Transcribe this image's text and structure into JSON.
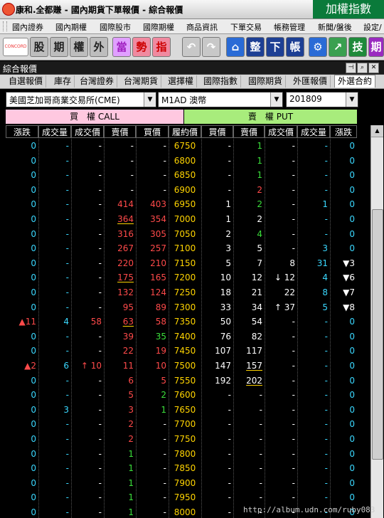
{
  "window": {
    "title": "康和.全都賺 - 國內期貨下單報價 - 綜合報價",
    "index_button": "加權指數"
  },
  "menu": [
    "國內證券",
    "國內期權",
    "國際股市",
    "國際期權",
    "商品資訊",
    "下單交易",
    "帳務管理",
    "新聞/盤後",
    "設定/"
  ],
  "toolbar": {
    "logo_text": "CONCORD",
    "buttons": [
      "股",
      "期",
      "權",
      "外",
      "當",
      "勢",
      "指",
      "整",
      "下",
      "帳",
      "技",
      "期"
    ]
  },
  "panel": {
    "title": "綜合報價"
  },
  "tabs": [
    "自選報價",
    "庫存",
    "台灣證券",
    "台灣期貨",
    "選擇權",
    "國際指數",
    "國際期貨",
    "外匯報價",
    "外選合約"
  ],
  "selectors": {
    "exchange": "美國芝加哥商業交易所(CME)",
    "product": "M1AD 澳幣",
    "month": "201809"
  },
  "sections": {
    "call": "買　權 CALL",
    "put": "賣　權 PUT"
  },
  "columns": [
    "漲跌",
    "成交量",
    "成交價",
    "賣價",
    "買價",
    "履約價",
    "買價",
    "賣價",
    "成交價",
    "成交量",
    "漲跌"
  ],
  "rows": [
    {
      "strike": "6750",
      "c": [
        [
          "0",
          "c"
        ],
        [
          "-",
          "c"
        ],
        [
          "-",
          "w"
        ],
        [
          "-",
          "w"
        ],
        [
          "-",
          "w"
        ]
      ],
      "p": [
        [
          "-",
          "w"
        ],
        [
          "1",
          "g"
        ],
        [
          "-",
          "w"
        ],
        [
          "-",
          "c"
        ],
        [
          "0",
          "c"
        ]
      ]
    },
    {
      "strike": "6800",
      "c": [
        [
          "0",
          "c"
        ],
        [
          "-",
          "c"
        ],
        [
          "-",
          "w"
        ],
        [
          "-",
          "w"
        ],
        [
          "-",
          "w"
        ]
      ],
      "p": [
        [
          "-",
          "w"
        ],
        [
          "1",
          "g"
        ],
        [
          "-",
          "w"
        ],
        [
          "-",
          "c"
        ],
        [
          "0",
          "c"
        ]
      ]
    },
    {
      "strike": "6850",
      "c": [
        [
          "0",
          "c"
        ],
        [
          "-",
          "c"
        ],
        [
          "-",
          "w"
        ],
        [
          "-",
          "w"
        ],
        [
          "-",
          "w"
        ]
      ],
      "p": [
        [
          "-",
          "w"
        ],
        [
          "1",
          "g"
        ],
        [
          "-",
          "w"
        ],
        [
          "-",
          "c"
        ],
        [
          "0",
          "c"
        ]
      ]
    },
    {
      "strike": "6900",
      "c": [
        [
          "0",
          "c"
        ],
        [
          "-",
          "c"
        ],
        [
          "-",
          "w"
        ],
        [
          "-",
          "w"
        ],
        [
          "-",
          "w"
        ]
      ],
      "p": [
        [
          "-",
          "w"
        ],
        [
          "2",
          "r"
        ],
        [
          "-",
          "w"
        ],
        [
          "-",
          "c"
        ],
        [
          "0",
          "c"
        ]
      ]
    },
    {
      "strike": "6950",
      "c": [
        [
          "0",
          "c"
        ],
        [
          "-",
          "c"
        ],
        [
          "-",
          "w"
        ],
        [
          "414",
          "r"
        ],
        [
          "403",
          "r"
        ]
      ],
      "p": [
        [
          "1",
          "w"
        ],
        [
          "2",
          "g"
        ],
        [
          "-",
          "w"
        ],
        [
          "1",
          "c"
        ],
        [
          "0",
          "c"
        ]
      ]
    },
    {
      "strike": "7000",
      "c": [
        [
          "0",
          "c"
        ],
        [
          "-",
          "c"
        ],
        [
          "-",
          "w"
        ],
        [
          "364",
          "r",
          "ul"
        ],
        [
          "354",
          "r"
        ]
      ],
      "p": [
        [
          "1",
          "w"
        ],
        [
          "2",
          "w"
        ],
        [
          "-",
          "w"
        ],
        [
          "-",
          "c"
        ],
        [
          "0",
          "c"
        ]
      ]
    },
    {
      "strike": "7050",
      "c": [
        [
          "0",
          "c"
        ],
        [
          "-",
          "c"
        ],
        [
          "-",
          "w"
        ],
        [
          "316",
          "r"
        ],
        [
          "305",
          "r"
        ]
      ],
      "p": [
        [
          "2",
          "w"
        ],
        [
          "4",
          "g"
        ],
        [
          "-",
          "w"
        ],
        [
          "-",
          "c"
        ],
        [
          "0",
          "c"
        ]
      ]
    },
    {
      "strike": "7100",
      "c": [
        [
          "0",
          "c"
        ],
        [
          "-",
          "c"
        ],
        [
          "-",
          "w"
        ],
        [
          "267",
          "r"
        ],
        [
          "257",
          "r"
        ]
      ],
      "p": [
        [
          "3",
          "w"
        ],
        [
          "5",
          "w"
        ],
        [
          "-",
          "w"
        ],
        [
          "3",
          "c"
        ],
        [
          "0",
          "c"
        ]
      ]
    },
    {
      "strike": "7150",
      "c": [
        [
          "0",
          "c"
        ],
        [
          "-",
          "c"
        ],
        [
          "-",
          "w"
        ],
        [
          "220",
          "r"
        ],
        [
          "210",
          "r"
        ]
      ],
      "p": [
        [
          "5",
          "w"
        ],
        [
          "7",
          "w"
        ],
        [
          "8",
          "w"
        ],
        [
          "31",
          "c"
        ],
        [
          "▼3",
          "w"
        ]
      ]
    },
    {
      "strike": "7200",
      "c": [
        [
          "0",
          "c"
        ],
        [
          "-",
          "c"
        ],
        [
          "-",
          "w"
        ],
        [
          "175",
          "r",
          "ul"
        ],
        [
          "165",
          "r"
        ]
      ],
      "p": [
        [
          "10",
          "w"
        ],
        [
          "12",
          "w"
        ],
        [
          "↓ 12",
          "w"
        ],
        [
          "4",
          "c"
        ],
        [
          "▼6",
          "w"
        ]
      ]
    },
    {
      "strike": "7250",
      "c": [
        [
          "0",
          "c"
        ],
        [
          "-",
          "c"
        ],
        [
          "-",
          "w"
        ],
        [
          "132",
          "r"
        ],
        [
          "124",
          "r"
        ]
      ],
      "p": [
        [
          "18",
          "w"
        ],
        [
          "21",
          "w"
        ],
        [
          "22",
          "w"
        ],
        [
          "8",
          "c"
        ],
        [
          "▼7",
          "w"
        ]
      ]
    },
    {
      "strike": "7300",
      "c": [
        [
          "0",
          "c"
        ],
        [
          "-",
          "c"
        ],
        [
          "-",
          "w"
        ],
        [
          "95",
          "r"
        ],
        [
          "89",
          "r"
        ]
      ],
      "p": [
        [
          "33",
          "w"
        ],
        [
          "34",
          "w"
        ],
        [
          "↑ 37",
          "w"
        ],
        [
          "5",
          "c"
        ],
        [
          "▼8",
          "w"
        ]
      ]
    },
    {
      "strike": "7350",
      "c": [
        [
          "▲11",
          "r"
        ],
        [
          "4",
          "c"
        ],
        [
          "58",
          "r"
        ],
        [
          "63",
          "r",
          "ul"
        ],
        [
          "58",
          "r"
        ]
      ],
      "p": [
        [
          "50",
          "w"
        ],
        [
          "54",
          "w"
        ],
        [
          "-",
          "w"
        ],
        [
          "-",
          "c"
        ],
        [
          "0",
          "c"
        ]
      ]
    },
    {
      "strike": "7400",
      "c": [
        [
          "0",
          "c"
        ],
        [
          "-",
          "c"
        ],
        [
          "-",
          "w"
        ],
        [
          "39",
          "r"
        ],
        [
          "35",
          "g"
        ]
      ],
      "p": [
        [
          "76",
          "w"
        ],
        [
          "82",
          "w"
        ],
        [
          "-",
          "w"
        ],
        [
          "-",
          "c"
        ],
        [
          "0",
          "c"
        ]
      ]
    },
    {
      "strike": "7450",
      "c": [
        [
          "0",
          "c"
        ],
        [
          "-",
          "c"
        ],
        [
          "-",
          "w"
        ],
        [
          "22",
          "r"
        ],
        [
          "19",
          "r"
        ]
      ],
      "p": [
        [
          "107",
          "w"
        ],
        [
          "117",
          "w"
        ],
        [
          "-",
          "w"
        ],
        [
          "-",
          "c"
        ],
        [
          "0",
          "c"
        ]
      ]
    },
    {
      "strike": "7500",
      "c": [
        [
          "▲2",
          "r"
        ],
        [
          "6",
          "c"
        ],
        [
          "↑ 10",
          "r"
        ],
        [
          "11",
          "r"
        ],
        [
          "10",
          "r"
        ]
      ],
      "p": [
        [
          "147",
          "w"
        ],
        [
          "157",
          "w",
          "ul"
        ],
        [
          "-",
          "w"
        ],
        [
          "-",
          "c"
        ],
        [
          "0",
          "c"
        ]
      ]
    },
    {
      "strike": "7550",
      "c": [
        [
          "0",
          "c"
        ],
        [
          "-",
          "c"
        ],
        [
          "-",
          "w"
        ],
        [
          "6",
          "r"
        ],
        [
          "5",
          "r"
        ]
      ],
      "p": [
        [
          "192",
          "w"
        ],
        [
          "202",
          "w",
          "ul"
        ],
        [
          "-",
          "w"
        ],
        [
          "-",
          "c"
        ],
        [
          "0",
          "c"
        ]
      ]
    },
    {
      "strike": "7600",
      "c": [
        [
          "0",
          "c"
        ],
        [
          "-",
          "c"
        ],
        [
          "-",
          "w"
        ],
        [
          "5",
          "r"
        ],
        [
          "2",
          "g"
        ]
      ],
      "p": [
        [
          "-",
          "w"
        ],
        [
          "-",
          "w"
        ],
        [
          "-",
          "w"
        ],
        [
          "-",
          "c"
        ],
        [
          "0",
          "c"
        ]
      ]
    },
    {
      "strike": "7650",
      "c": [
        [
          "0",
          "c"
        ],
        [
          "3",
          "c"
        ],
        [
          "-",
          "w"
        ],
        [
          "3",
          "r"
        ],
        [
          "1",
          "g"
        ]
      ],
      "p": [
        [
          "-",
          "w"
        ],
        [
          "-",
          "w"
        ],
        [
          "-",
          "w"
        ],
        [
          "-",
          "c"
        ],
        [
          "0",
          "c"
        ]
      ]
    },
    {
      "strike": "7700",
      "c": [
        [
          "0",
          "c"
        ],
        [
          "-",
          "c"
        ],
        [
          "-",
          "w"
        ],
        [
          "2",
          "r"
        ],
        [
          "-",
          "w"
        ]
      ],
      "p": [
        [
          "-",
          "w"
        ],
        [
          "-",
          "w"
        ],
        [
          "-",
          "w"
        ],
        [
          "-",
          "c"
        ],
        [
          "0",
          "c"
        ]
      ]
    },
    {
      "strike": "7750",
      "c": [
        [
          "0",
          "c"
        ],
        [
          "-",
          "c"
        ],
        [
          "-",
          "w"
        ],
        [
          "2",
          "r"
        ],
        [
          "-",
          "w"
        ]
      ],
      "p": [
        [
          "-",
          "w"
        ],
        [
          "-",
          "w"
        ],
        [
          "-",
          "w"
        ],
        [
          "-",
          "c"
        ],
        [
          "0",
          "c"
        ]
      ]
    },
    {
      "strike": "7800",
      "c": [
        [
          "0",
          "c"
        ],
        [
          "-",
          "c"
        ],
        [
          "-",
          "w"
        ],
        [
          "1",
          "g"
        ],
        [
          "-",
          "w"
        ]
      ],
      "p": [
        [
          "-",
          "w"
        ],
        [
          "-",
          "w"
        ],
        [
          "-",
          "w"
        ],
        [
          "-",
          "c"
        ],
        [
          "0",
          "c"
        ]
      ]
    },
    {
      "strike": "7850",
      "c": [
        [
          "0",
          "c"
        ],
        [
          "-",
          "c"
        ],
        [
          "-",
          "w"
        ],
        [
          "1",
          "g"
        ],
        [
          "-",
          "w"
        ]
      ],
      "p": [
        [
          "-",
          "w"
        ],
        [
          "-",
          "w"
        ],
        [
          "-",
          "w"
        ],
        [
          "-",
          "c"
        ],
        [
          "0",
          "c"
        ]
      ]
    },
    {
      "strike": "7900",
      "c": [
        [
          "0",
          "c"
        ],
        [
          "-",
          "c"
        ],
        [
          "-",
          "w"
        ],
        [
          "1",
          "g"
        ],
        [
          "-",
          "w"
        ]
      ],
      "p": [
        [
          "-",
          "w"
        ],
        [
          "-",
          "w"
        ],
        [
          "-",
          "w"
        ],
        [
          "-",
          "c"
        ],
        [
          "0",
          "c"
        ]
      ]
    },
    {
      "strike": "7950",
      "c": [
        [
          "0",
          "c"
        ],
        [
          "-",
          "c"
        ],
        [
          "-",
          "w"
        ],
        [
          "1",
          "g"
        ],
        [
          "-",
          "w"
        ]
      ],
      "p": [
        [
          "-",
          "w"
        ],
        [
          "-",
          "w"
        ],
        [
          "-",
          "w"
        ],
        [
          "-",
          "c"
        ],
        [
          "0",
          "c"
        ]
      ]
    },
    {
      "strike": "8000",
      "c": [
        [
          "0",
          "c"
        ],
        [
          "-",
          "c"
        ],
        [
          "-",
          "w"
        ],
        [
          "1",
          "g"
        ],
        [
          "-",
          "w"
        ]
      ],
      "p": [
        [
          "-",
          "w"
        ],
        [
          "-",
          "w"
        ],
        [
          "-",
          "w"
        ],
        [
          "-",
          "c"
        ],
        [
          "0",
          "c"
        ]
      ]
    }
  ],
  "watermark": "http://album.udn.com/ruby083"
}
